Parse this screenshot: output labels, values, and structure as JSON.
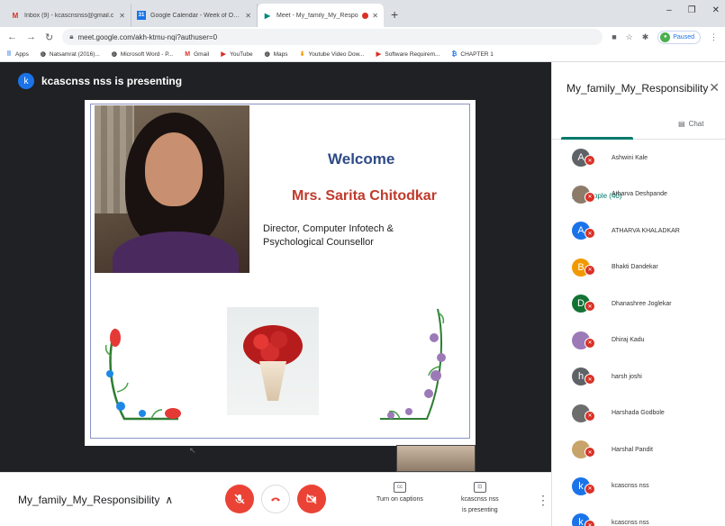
{
  "browser": {
    "tabs": [
      {
        "icon": "gmail-icon",
        "title": "Inbox (9) - kcascnsnss@gmail.c",
        "active": false
      },
      {
        "icon": "calendar-icon",
        "title": "Google Calendar - Week of Octo",
        "active": false
      },
      {
        "icon": "meet-icon",
        "title": "Meet - My_family_My_Respo",
        "active": true
      }
    ],
    "new_tab": "+",
    "window_controls": [
      "–",
      "❐",
      "✕"
    ],
    "url": "meet.google.com/akh-ktmu-nqi?authuser=0",
    "profile_status": "Paused",
    "bookmarks": [
      {
        "icon": "apps-icon",
        "label": "Apps"
      },
      {
        "icon": "globe-icon",
        "label": "Natsamrat (2016)..."
      },
      {
        "icon": "globe-icon",
        "label": "Microsoft Word - P..."
      },
      {
        "icon": "gmail-icon",
        "label": "Gmail"
      },
      {
        "icon": "youtube-icon",
        "label": "YouTube"
      },
      {
        "icon": "maps-icon",
        "label": "Maps"
      },
      {
        "icon": "download-icon",
        "label": "Youtube Video Dow..."
      },
      {
        "icon": "youtube-icon",
        "label": "Software Requirem..."
      },
      {
        "icon": "book-icon",
        "label": "CHAPTER 1"
      }
    ]
  },
  "meet": {
    "presenter_initial": "k",
    "presenter_label": "kcascnss nss is presenting",
    "slide": {
      "welcome": "Welcome",
      "name": "Mrs. Sarita Chitodkar",
      "role_line1": "Director, Computer Infotech &",
      "role_line2": "Psychological Counsellor"
    },
    "meeting_name": "My_family_My_Responsibility",
    "captions_label": "Turn on captions",
    "captions_icon_text": "cc",
    "presenting_label_line1": "kcascnss nss",
    "presenting_label_line2": "is presenting"
  },
  "panel": {
    "title": "My_family_My_Responsibility",
    "people_tab": "People (40)",
    "chat_tab": "Chat",
    "people": [
      {
        "initial": "A",
        "name": "Ashwini Kale",
        "color": "#5f6368"
      },
      {
        "initial": "",
        "name": "Atharva Deshpande",
        "color": "#8d7b6a"
      },
      {
        "initial": "A",
        "name": "ATHARVA KHALADKAR",
        "color": "#1a73e8"
      },
      {
        "initial": "B",
        "name": "Bhakti Dandekar",
        "color": "#f29900"
      },
      {
        "initial": "D",
        "name": "Dhanashree Joglekar",
        "color": "#137333"
      },
      {
        "initial": "",
        "name": "Dhiraj Kadu",
        "color": "#9c7ab8"
      },
      {
        "initial": "h",
        "name": "harsh joshi",
        "color": "#5f6368"
      },
      {
        "initial": "",
        "name": "Harshada Godbole",
        "color": "#6d6d6d"
      },
      {
        "initial": "",
        "name": "Harshal Pandit",
        "color": "#c8a46a"
      },
      {
        "initial": "k",
        "name": "kcascnss nss",
        "color": "#1a73e8"
      },
      {
        "initial": "k",
        "name": "kcascnss nss",
        "color": "#1a73e8"
      }
    ]
  }
}
